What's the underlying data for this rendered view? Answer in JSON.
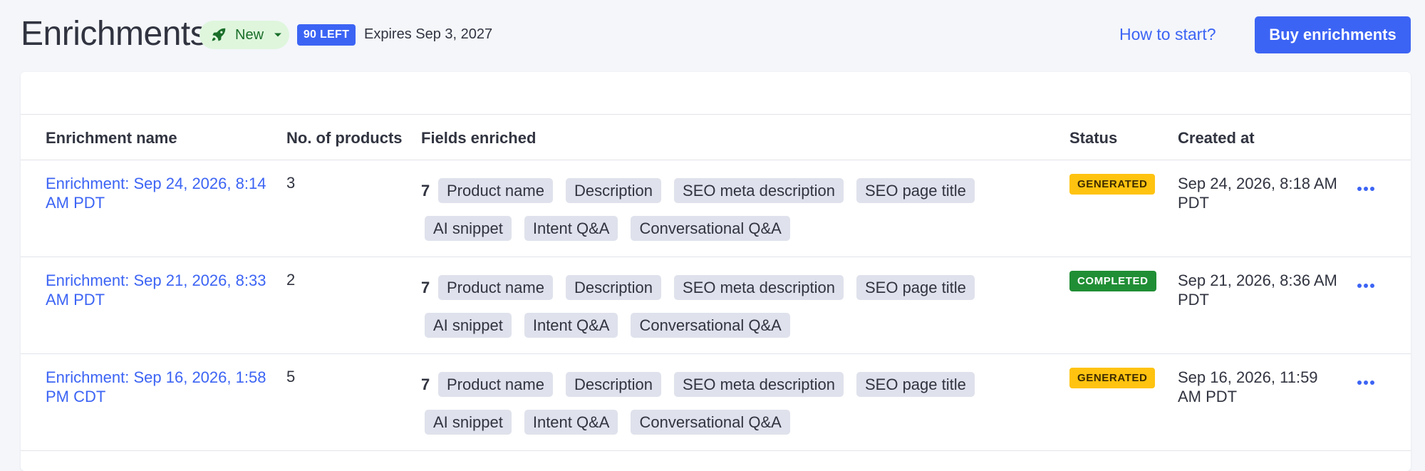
{
  "header": {
    "title": "Enrichments",
    "new_badge": "New",
    "left_badge": "90 LEFT",
    "expires": "Expires Sep 3, 2027",
    "how_to_start": "How to start?",
    "buy_button": "Buy enrichments"
  },
  "table": {
    "columns": {
      "name": "Enrichment name",
      "products": "No. of products",
      "fields": "Fields enriched",
      "status": "Status",
      "created": "Created at"
    },
    "rows": [
      {
        "name": "Enrichment: Sep 24, 2026, 8:14 AM PDT",
        "products": "3",
        "field_count": "7",
        "fields": [
          "Product name",
          "Description",
          "SEO meta description",
          "SEO page title",
          "AI snippet",
          "Intent Q&A",
          "Conversational Q&A"
        ],
        "status": "GENERATED",
        "created": "Sep 24, 2026, 8:18 AM PDT"
      },
      {
        "name": "Enrichment: Sep 21, 2026, 8:33 AM PDT",
        "products": "2",
        "field_count": "7",
        "fields": [
          "Product name",
          "Description",
          "SEO meta description",
          "SEO page title",
          "AI snippet",
          "Intent Q&A",
          "Conversational Q&A"
        ],
        "status": "COMPLETED",
        "created": "Sep 21, 2026, 8:36 AM PDT"
      },
      {
        "name": "Enrichment: Sep 16, 2026, 1:58 PM CDT",
        "products": "5",
        "field_count": "7",
        "fields": [
          "Product name",
          "Description",
          "SEO meta description",
          "SEO page title",
          "AI snippet",
          "Intent Q&A",
          "Conversational Q&A"
        ],
        "status": "GENERATED",
        "created": "Sep 16, 2026, 11:59 AM PDT"
      }
    ]
  },
  "colors": {
    "accent": "#3c64f4",
    "generated": "#ffc310",
    "completed": "#208e35",
    "chip": "#dfe2ec",
    "new_badge_bg": "#dff6dd"
  },
  "icons": {
    "new_badge": "rocket-icon",
    "dropdown": "caret-down-icon",
    "row_menu": "more-horizontal-icon"
  }
}
